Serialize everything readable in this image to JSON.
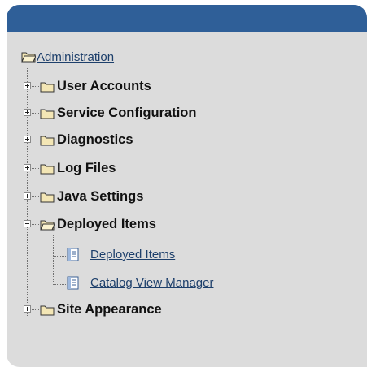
{
  "root": {
    "label": "Administration",
    "icon": "folder-open-icon"
  },
  "categories": [
    {
      "label": "User Accounts",
      "state": "collapsed"
    },
    {
      "label": "Service Configuration",
      "state": "collapsed"
    },
    {
      "label": "Diagnostics",
      "state": "collapsed"
    },
    {
      "label": "Log Files",
      "state": "collapsed"
    },
    {
      "label": "Java Settings",
      "state": "collapsed"
    },
    {
      "label": "Deployed Items",
      "state": "expanded"
    },
    {
      "label": "Site Appearance",
      "state": "collapsed"
    }
  ],
  "deployed_children": [
    {
      "label": "Deployed Items",
      "icon": "document-icon"
    },
    {
      "label": "Catalog View Manager",
      "icon": "document-icon"
    }
  ],
  "colors": {
    "header": "#2f5f98",
    "panel": "#dcdcdc",
    "link": "#1d3f6b",
    "folder": "#f3e6b5"
  }
}
